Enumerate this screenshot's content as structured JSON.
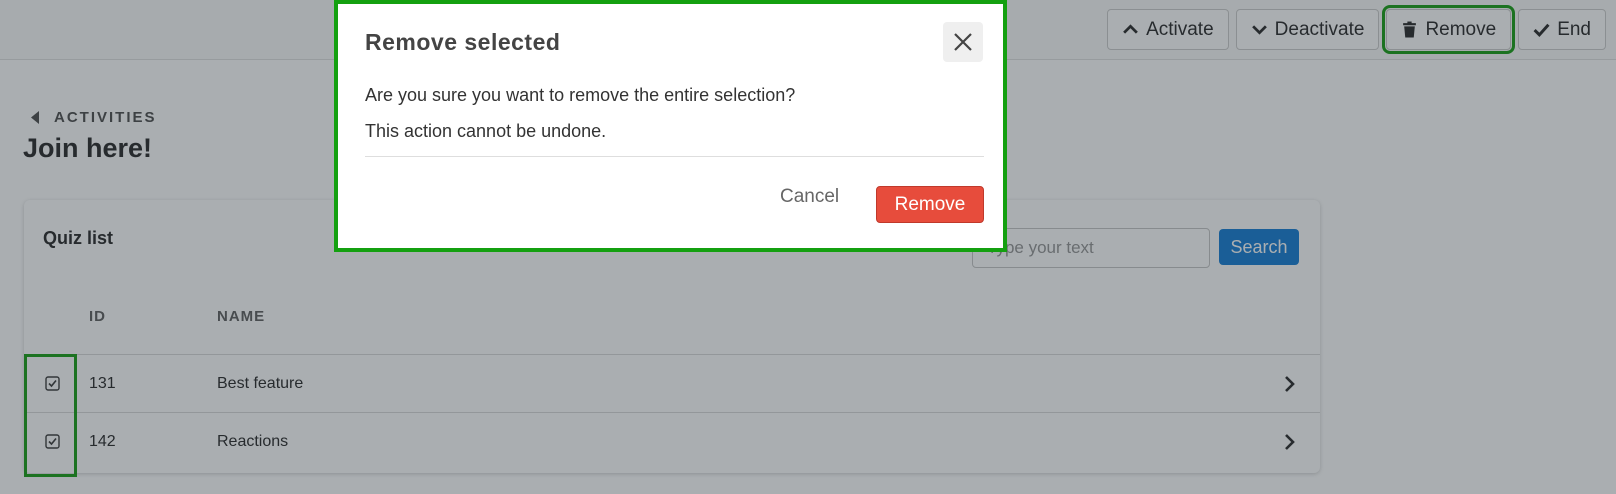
{
  "toolbar": {
    "activate_label": "Activate",
    "deactivate_label": "Deactivate",
    "remove_label": "Remove",
    "end_label": "End"
  },
  "breadcrumb": {
    "label": "ACTIVITIES"
  },
  "page": {
    "title": "Join here!"
  },
  "quiz_list": {
    "title": "Quiz list",
    "search_placeholder": "Type your text",
    "search_label": "Search",
    "columns": [
      "ID",
      "NAME"
    ],
    "rows": [
      {
        "id": "131",
        "name": "Best feature",
        "checked": true
      },
      {
        "id": "142",
        "name": "Reactions",
        "checked": true
      }
    ]
  },
  "modal": {
    "title": "Remove selected",
    "message": "Are you sure you want to remove the entire selection?",
    "warning": "This action cannot be undone.",
    "cancel_label": "Cancel",
    "confirm_label": "Remove"
  },
  "colors": {
    "highlight": "#22a21f",
    "primary": "#1e83d6",
    "danger": "#e74c3c"
  },
  "icons": {
    "activate": "chevron-up-icon",
    "deactivate": "chevron-down-icon",
    "remove": "trash-icon",
    "end": "check-icon",
    "breadcrumb": "caret-left-icon",
    "row": "chevron-right-icon",
    "close": "close-icon"
  }
}
